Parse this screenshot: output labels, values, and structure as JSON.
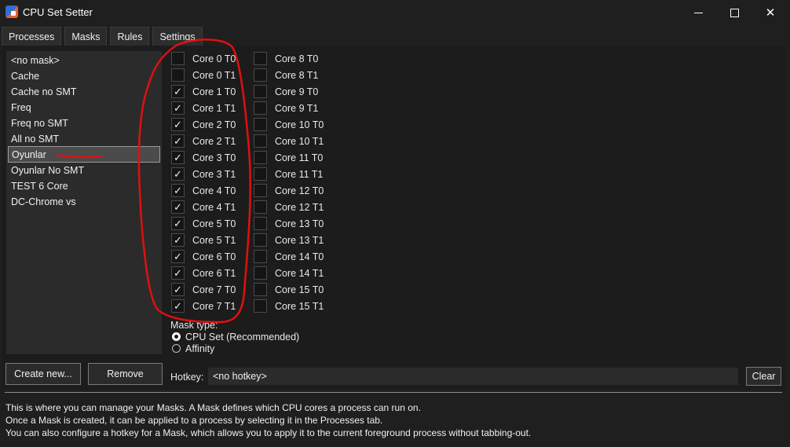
{
  "window": {
    "title": "CPU Set Setter",
    "controls": {
      "minimize": "minimize-icon",
      "maximize": "maximize-icon",
      "close": "✕"
    }
  },
  "menu": [
    "Processes",
    "Masks",
    "Rules",
    "Settings"
  ],
  "masks": {
    "items": [
      "<no mask>",
      "Cache",
      "Cache no SMT",
      "Freq",
      "Freq no SMT",
      "All no SMT",
      "Oyunlar",
      "Oyunlar No SMT",
      "TEST 6 Core",
      "DC-Chrome vs"
    ],
    "selected": "Oyunlar"
  },
  "cores": {
    "column1": [
      {
        "label": "Core 0 T0",
        "checked": false
      },
      {
        "label": "Core 0 T1",
        "checked": false
      },
      {
        "label": "Core 1 T0",
        "checked": true
      },
      {
        "label": "Core 1 T1",
        "checked": true
      },
      {
        "label": "Core 2 T0",
        "checked": true
      },
      {
        "label": "Core 2 T1",
        "checked": true
      },
      {
        "label": "Core 3 T0",
        "checked": true
      },
      {
        "label": "Core 3 T1",
        "checked": true
      },
      {
        "label": "Core 4 T0",
        "checked": true
      },
      {
        "label": "Core 4 T1",
        "checked": true
      },
      {
        "label": "Core 5 T0",
        "checked": true
      },
      {
        "label": "Core 5 T1",
        "checked": true
      },
      {
        "label": "Core 6 T0",
        "checked": true
      },
      {
        "label": "Core 6 T1",
        "checked": true
      },
      {
        "label": "Core 7 T0",
        "checked": true
      },
      {
        "label": "Core 7 T1",
        "checked": true
      }
    ],
    "column2": [
      {
        "label": "Core 8 T0",
        "checked": false
      },
      {
        "label": "Core 8 T1",
        "checked": false
      },
      {
        "label": "Core 9 T0",
        "checked": false
      },
      {
        "label": "Core 9 T1",
        "checked": false
      },
      {
        "label": "Core 10 T0",
        "checked": false
      },
      {
        "label": "Core 10 T1",
        "checked": false
      },
      {
        "label": "Core 11 T0",
        "checked": false
      },
      {
        "label": "Core 11 T1",
        "checked": false
      },
      {
        "label": "Core 12 T0",
        "checked": false
      },
      {
        "label": "Core 12 T1",
        "checked": false
      },
      {
        "label": "Core 13 T0",
        "checked": false
      },
      {
        "label": "Core 13 T1",
        "checked": false
      },
      {
        "label": "Core 14 T0",
        "checked": false
      },
      {
        "label": "Core 14 T1",
        "checked": false
      },
      {
        "label": "Core 15 T0",
        "checked": false
      },
      {
        "label": "Core 15 T1",
        "checked": false
      }
    ],
    "check_glyph": "✓"
  },
  "mask_type": {
    "label": "Mask type:",
    "options": [
      {
        "label": "CPU Set (Recommended)",
        "checked": true
      },
      {
        "label": "Affinity",
        "checked": false
      }
    ]
  },
  "buttons": {
    "create": "Create new...",
    "remove": "Remove",
    "clear": "Clear"
  },
  "hotkey": {
    "label": "Hotkey:",
    "value": "<no hotkey>"
  },
  "help": [
    "This is where you can manage your Masks. A Mask defines which CPU cores a process can run on.",
    "Once a Mask is created, it can be applied to a process by selecting it in the Processes tab.",
    "You can also configure a hotkey for a Mask, which allows you to apply it to the current foreground process without tabbing-out."
  ],
  "colors": {
    "annotation": "#e01010",
    "background": "#1f1f1f",
    "panel": "#2b2b2b",
    "selection": "#4b4b4b"
  }
}
